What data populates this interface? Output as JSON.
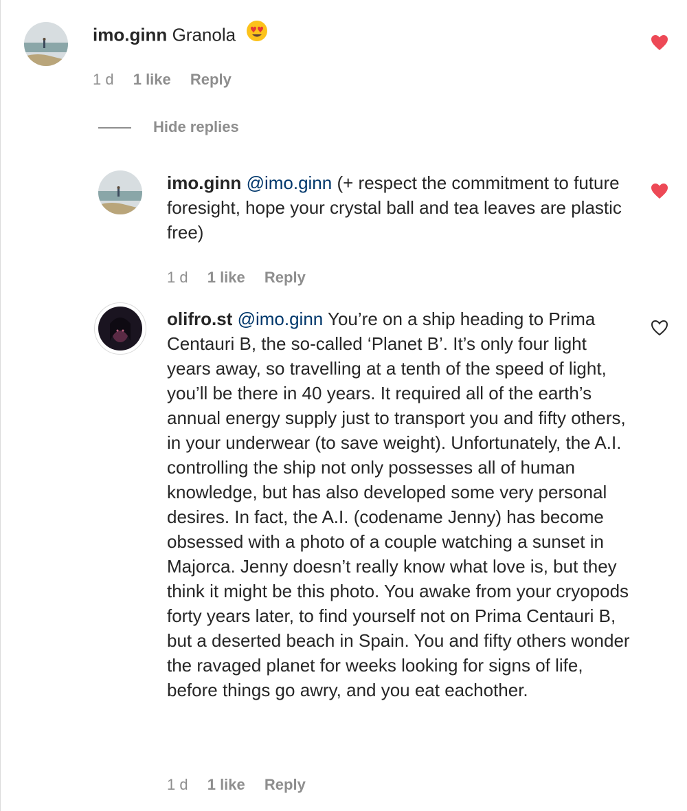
{
  "comments": [
    {
      "username": "imo.ginn",
      "text": "Granola",
      "emoji": "heart-eyes-emoji",
      "time": "1 d",
      "likes": "1 like",
      "reply_label": "Reply",
      "liked": true
    }
  ],
  "hide_replies_label": "Hide replies",
  "replies": [
    {
      "username": "imo.ginn",
      "mention": "@imo.ginn",
      "text": "(+ respect the commitment to future foresight, hope your crystal ball and tea leaves are plastic free)",
      "time": "1 d",
      "likes": "1 like",
      "reply_label": "Reply",
      "liked": true
    },
    {
      "username": "olifro.st",
      "mention": "@imo.ginn",
      "text": "You’re on a ship heading to Prima Centauri B, the so-called ‘Planet B’. It’s only four light years away, so travelling at a tenth of the speed of light, you’ll be there in 40 years. It required all of the earth’s annual energy supply just to transport you and fifty others, in your underwear (to save weight). Unfortunately, the A.I. controlling the ship not only possesses all of human knowledge, but has also developed some very personal desires. In fact, the A.I. (codename Jenny) has become obsessed with a photo of a couple watching a sunset in Majorca. Jenny doesn’t really know what love is, but they think it might be this photo. You awake from your cryopods forty years later, to find yourself not on Prima Centauri B, but a deserted beach in Spain. You and fifty others wonder the ravaged planet for weeks looking for signs of life, before things go awry, and you eat eachother.",
      "time": "1 d",
      "likes": "1 like",
      "reply_label": "Reply",
      "liked": false
    }
  ],
  "colors": {
    "liked_heart": "#ed4956",
    "meta_text": "#8e8e8e",
    "mention": "#00376b"
  }
}
